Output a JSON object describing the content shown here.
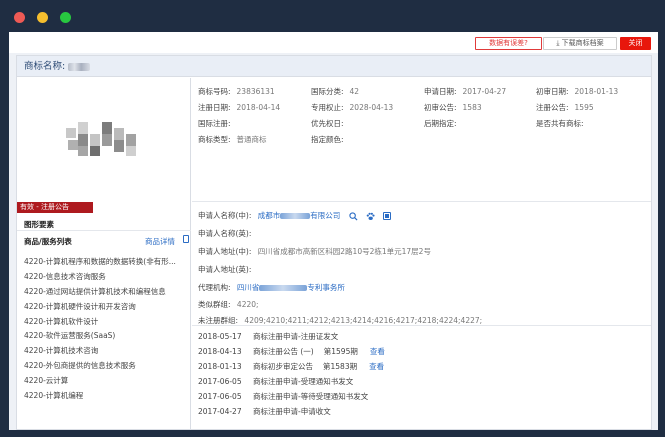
{
  "topbar": {
    "error_report": "数据有误差?",
    "download": "下载商标档案",
    "close": "关闭"
  },
  "title": {
    "label": "商标名称:"
  },
  "left": {
    "status": "有效 - 注册公告",
    "figure_label": "图形要素",
    "goods_title": "商品/服务列表",
    "goods_link": "商品详情",
    "goods": [
      "4220-计算机程序和数据的数据转换(非有形...",
      "4220-信息技术咨询服务",
      "4220-通过网站提供计算机技术和编程信息",
      "4220-计算机硬件设计和开发咨询",
      "4220-计算机软件设计",
      "4220-软件运营服务(SaaS)",
      "4220-计算机技术咨询",
      "4220-外包商提供的信息技术服务",
      "4220-云计算",
      "4220-计算机编程"
    ]
  },
  "info": {
    "reg_no_label": "商标号码:",
    "reg_no": "23836131",
    "intl_class_label": "国际分类:",
    "intl_class": "42",
    "apply_date_label": "申请日期:",
    "apply_date": "2017-04-27",
    "prelim_date_label": "初审日期:",
    "prelim_date": "2018-01-13",
    "reg_date_label": "注册日期:",
    "reg_date": "2018-04-14",
    "exclusive_label": "专用权止:",
    "exclusive": "2028-04-13",
    "prelim_notice_label": "初审公告:",
    "prelim_notice": "1583",
    "reg_notice_label": "注册公告:",
    "reg_notice": "1595",
    "intl_reg_label": "国际注册:",
    "priority_label": "优先权日:",
    "later_designation_label": "后期指定:",
    "shared_label": "是否共有商标:",
    "type_label": "商标类型:",
    "type": "普通商标",
    "color_label": "指定颜色:"
  },
  "applicant": {
    "name_cn_label": "申请人名称(中):",
    "name_cn_prefix": "成都市",
    "name_cn_suffix": "有限公司",
    "name_en_label": "申请人名称(英):",
    "addr_cn_label": "申请人地址(中):",
    "addr_cn": "四川省成都市高新区科园2路10号2栋1单元17层2号",
    "addr_en_label": "申请人地址(英):",
    "agent_label": "代理机构:",
    "agent_prefix": "四川省",
    "agent_suffix": "专利事务所",
    "similar_group_label": "类似群组:",
    "similar_group": "4220;",
    "unregistered_group_label": "未注册群组:",
    "unregistered_group": "4209;4210;4211;4212;4213;4214;4216;4217;4218;4224;4227;"
  },
  "timeline": [
    {
      "date": "2018-05-17",
      "event": "商标注册申请-注册证发文",
      "issue": "",
      "link": ""
    },
    {
      "date": "2018-04-13",
      "event": "商标注册公告 (一)",
      "issue": "第1595期",
      "link": "查看"
    },
    {
      "date": "2018-01-13",
      "event": "商标初步审定公告",
      "issue": "第1583期",
      "link": "查看"
    },
    {
      "date": "2017-06-05",
      "event": "商标注册申请-受理通知书发文",
      "issue": "",
      "link": ""
    },
    {
      "date": "2017-06-05",
      "event": "商标注册申请-等待受理通知书发文",
      "issue": "",
      "link": ""
    },
    {
      "date": "2017-04-27",
      "event": "商标注册申请-申请收文",
      "issue": "",
      "link": ""
    }
  ],
  "colors": {
    "accent": "#2b6cc4",
    "status_badge": "#ae1a1f",
    "close_button": "#e8170c"
  }
}
